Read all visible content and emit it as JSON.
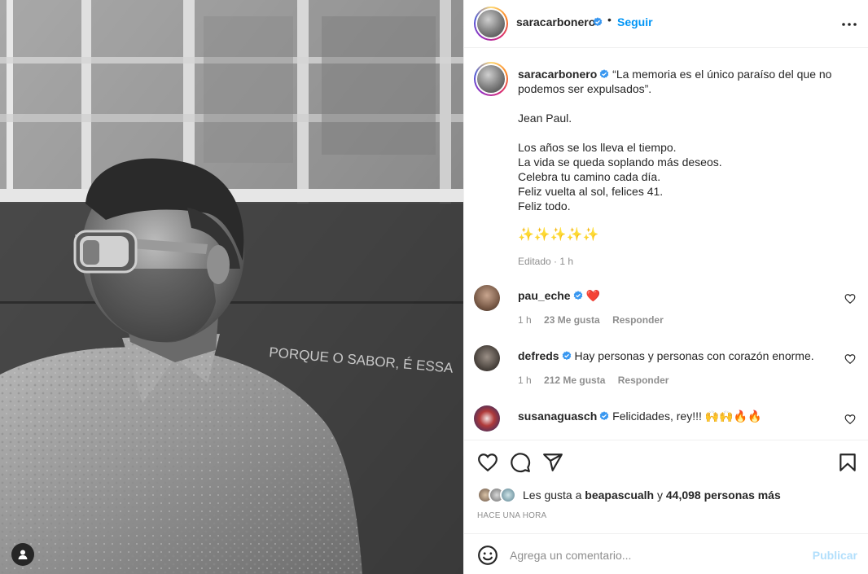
{
  "header": {
    "username": "saracarbonero",
    "separator": "•",
    "follow_label": "Seguir"
  },
  "caption": {
    "username": "saracarbonero",
    "lines": [
      "“La memoria es el único paraíso del que no",
      "podemos ser expulsados”.",
      "",
      "Jean Paul.",
      "",
      "Los años se los lleva el tiempo.",
      "La vida se queda soplando más deseos.",
      "Celebra tu camino cada día.",
      "Feliz vuelta al sol, felices 41.",
      "Feliz todo.",
      "",
      "✨✨✨✨✨"
    ],
    "edited": "Editado · 1 h"
  },
  "comments": [
    {
      "username": "pau_eche",
      "text": "❤️",
      "time": "1 h",
      "likes": "23 Me gusta",
      "reply": "Responder"
    },
    {
      "username": "defreds",
      "text": "Hay personas y personas con corazón enorme.",
      "time": "1 h",
      "likes": "212 Me gusta",
      "reply": "Responder"
    },
    {
      "username": "susanaguasch",
      "text": "Felicidades, rey!!! 🙌🙌🔥🔥",
      "time": "",
      "likes": "",
      "reply": ""
    }
  ],
  "likes": {
    "prefix": "Les gusta a ",
    "first_user": "beapascualh",
    "middle": " y ",
    "count": "44,098 personas más"
  },
  "time_ago": "HACE UNA HORA",
  "composer": {
    "placeholder": "Agrega un comentario...",
    "publish_label": "Publicar"
  },
  "icons": {
    "verified": "verified-badge-icon",
    "more": "more-options-icon",
    "like": "heart-icon",
    "comment": "comment-icon",
    "share": "share-icon",
    "save": "bookmark-icon",
    "emoji": "emoji-icon",
    "tag": "user-tag-icon"
  },
  "colors": {
    "accent": "#0095f6",
    "verified": "#3897f0",
    "publish_disabled": "#b2dffc",
    "muted": "#8e8e8e",
    "border": "#efefef"
  },
  "photo_text": "PORQUE O SABOR, É ESSA"
}
